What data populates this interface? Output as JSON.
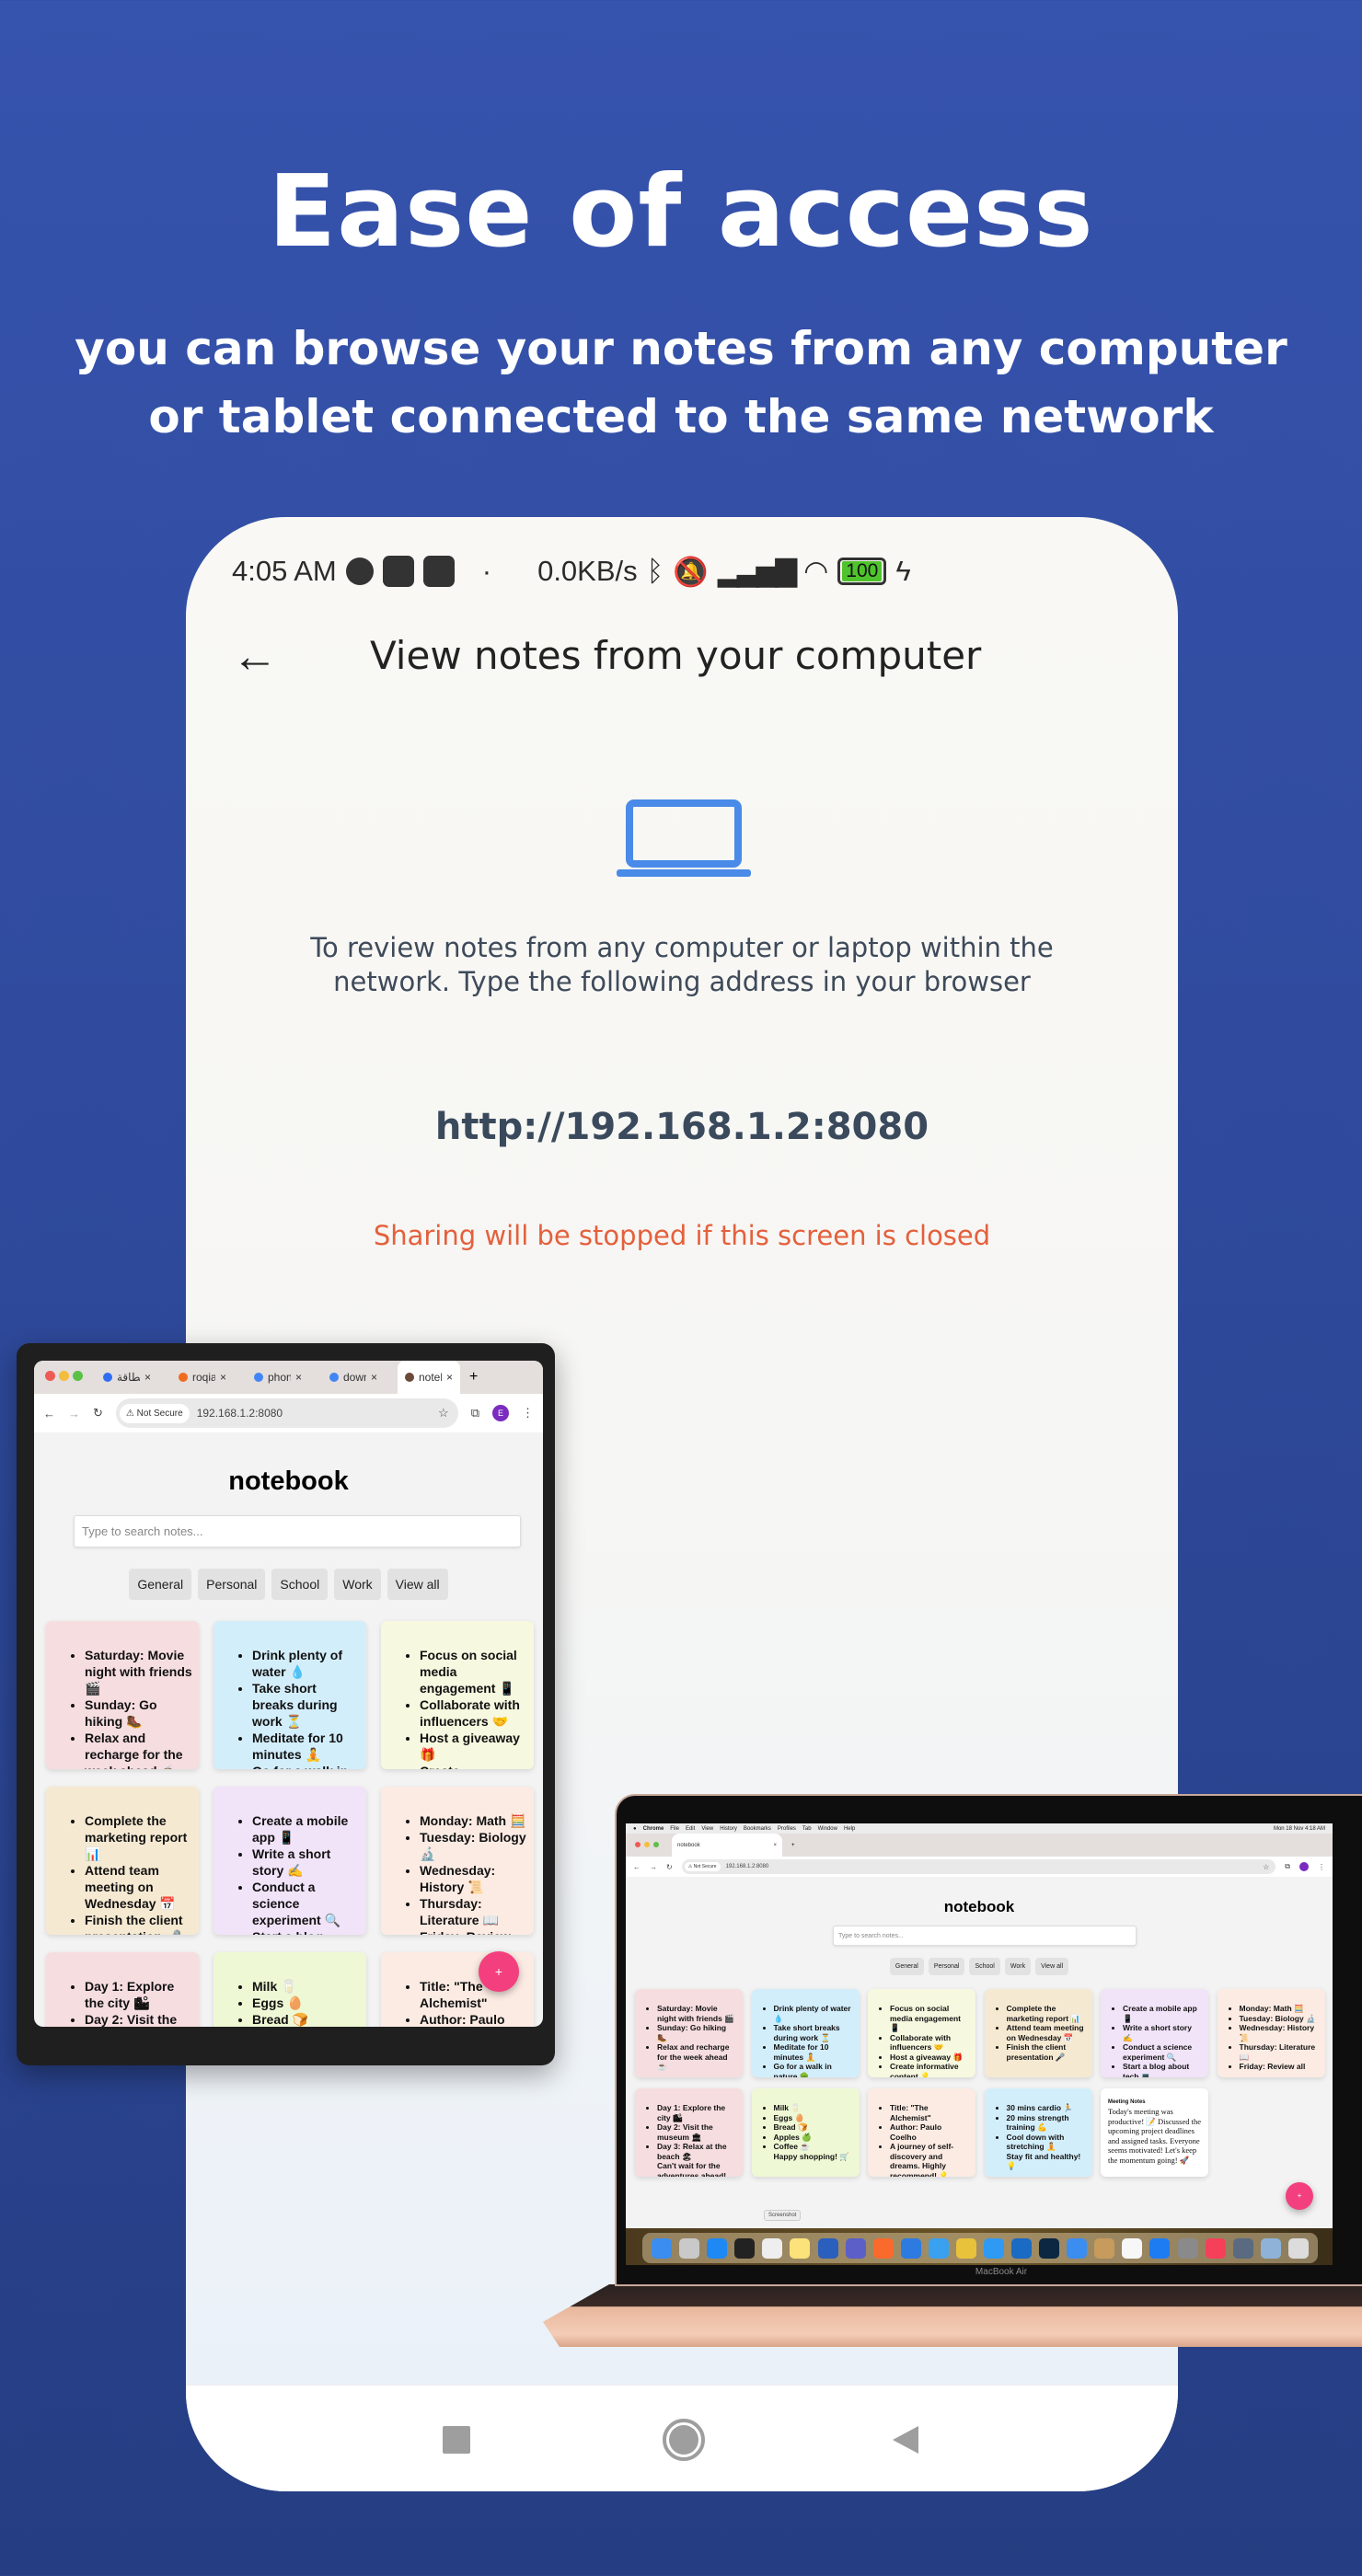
{
  "hero": {
    "title": "Ease of access",
    "subtitle_line1": "you can browse your notes from any computer",
    "subtitle_line2": "or tablet connected to the same network"
  },
  "phone": {
    "status": {
      "time": "4:05 AM",
      "speed": "0.0KB/s",
      "battery": "100"
    },
    "title": "View notes from your computer",
    "description": "To review notes from any computer or laptop within the network. Type the following address in your browser",
    "url": "http://192.168.1.2:8080",
    "warning": "Sharing will be stopped if this screen is closed",
    "colors": {
      "accent": "#4a8ae8",
      "warning": "#e4603c"
    }
  },
  "browser": {
    "not_secure": "Not Secure",
    "address": "192.168.1.2:8080",
    "tablet_tabs": [
      "بطاقة",
      "roqia",
      "phon",
      "down",
      "noteb"
    ],
    "laptop_tab": "notebook",
    "mac_menu": [
      "Chrome",
      "File",
      "Edit",
      "View",
      "History",
      "Bookmarks",
      "Profiles",
      "Tab",
      "Window",
      "Help"
    ],
    "mac_clock": "Mon 18 Nov 4:18 AM",
    "profile_initial": "E"
  },
  "notebook": {
    "title": "notebook",
    "search_placeholder": "Type to search notes...",
    "filters": [
      "General",
      "Personal",
      "School",
      "Work",
      "View all"
    ],
    "fab": "+",
    "notes": [
      {
        "color": "#f6dde0",
        "items": [
          "Saturday: Movie night with friends 🎬",
          "Sunday: Go hiking 🥾",
          "Relax and recharge for the week ahead ☕"
        ]
      },
      {
        "color": "#d3eefb",
        "items": [
          "Drink plenty of water 💧",
          "Take short breaks during work ⏳",
          "Meditate for 10 minutes 🧘",
          "Go for a walk in nature 🌳"
        ]
      },
      {
        "color": "#f6f8df",
        "items": [
          "Focus on social media engagement 📱",
          "Collaborate with influencers 🤝",
          "Host a giveaway 🎁",
          "Create informative content 💡"
        ]
      },
      {
        "color": "#f6e9d2",
        "items": [
          "Complete the marketing report 📊",
          "Attend team meeting on Wednesday 📅",
          "Finish the client presentation 🎤"
        ]
      },
      {
        "color": "#f1e3f8",
        "items": [
          "Create a mobile app 📱",
          "Write a short story ✍",
          "Conduct a science experiment 🔍",
          "Start a blog about tech 💻"
        ]
      },
      {
        "color": "#fbebe3",
        "items": [
          "Monday: Math 🧮",
          "Tuesday: Biology 🔬",
          "Wednesday: History 📜",
          "Thursday: Literature 📖",
          "Friday: Review all"
        ]
      },
      {
        "color": "#f6dde0",
        "items": [
          "Day 1: Explore the city 🏙",
          "Day 2: Visit the museum 🏛",
          "Day 3: Relax at the beach 🏖"
        ],
        "footer": "Can't wait for the adventures ahead!"
      },
      {
        "color": "#eef8d4",
        "items": [
          "Milk 🥛",
          "Eggs 🥚",
          "Bread 🍞",
          "Apples 🍏",
          "Coffee ☕"
        ],
        "footer": "Happy shopping! 🛒"
      },
      {
        "color": "#fbebe3",
        "items": [
          "Title: \"The Alchemist\"",
          "Author: Paulo Coelho",
          "A journey of self-discovery and dreams. Highly recommend! 💡"
        ]
      },
      {
        "color": "#d3eefb",
        "items": [
          "30 mins cardio 🏃",
          "20 mins strength training 💪",
          "Cool down with stretching 🧘"
        ],
        "footer": "Stay fit and healthy! 💡"
      },
      {
        "color": "#ffffff",
        "title": "Meeting Notes",
        "body": "Today's meeting was productive! 📝 Discussed the upcoming project deadlines and assigned tasks. Everyone seems motivated! Let's keep the momentum going! 🚀"
      }
    ]
  },
  "laptop": {
    "tooltip": "Screenshot",
    "model": "MacBook Air",
    "dock": [
      {
        "icon": "finder-icon",
        "color": "#3b8df0"
      },
      {
        "icon": "launchpad-icon",
        "color": "#c9c9c9"
      },
      {
        "icon": "app-store-icon",
        "color": "#1e88f5"
      },
      {
        "icon": "terminal-icon",
        "color": "#222"
      },
      {
        "icon": "screenshot-icon",
        "color": "#eee"
      },
      {
        "icon": "notes-icon",
        "color": "#fbe27a"
      },
      {
        "icon": "word-icon",
        "color": "#2b5fbd"
      },
      {
        "icon": "teams-icon",
        "color": "#5b5fc7"
      },
      {
        "icon": "pencil-app-icon",
        "color": "#fa6a2c"
      },
      {
        "icon": "xcode-instruments-icon",
        "color": "#2d7be0"
      },
      {
        "icon": "xcode-icon",
        "color": "#3aa0f0"
      },
      {
        "icon": "chrome-icon",
        "color": "#e9c23c"
      },
      {
        "icon": "safari-icon",
        "color": "#2e9af3"
      },
      {
        "icon": "outlook-icon",
        "color": "#1b6ac4"
      },
      {
        "icon": "photoshop-icon",
        "color": "#0b2741"
      },
      {
        "icon": "simulator-icon",
        "color": "#3b8df0"
      },
      {
        "icon": "contacts-icon",
        "color": "#c79a5e"
      },
      {
        "icon": "reminders-icon",
        "color": "#f7f7f7"
      },
      {
        "icon": "bluetooth-icon",
        "color": "#1e7cf2"
      },
      {
        "icon": "system-settings-icon",
        "color": "#8a8a8a"
      },
      {
        "icon": "music-icon",
        "color": "#f6405a"
      },
      {
        "icon": "quicktime-icon",
        "color": "#5a6a80"
      },
      {
        "icon": "preview-icon",
        "color": "#8fb3d8"
      },
      {
        "icon": "trash-icon",
        "color": "#dcdcdc"
      }
    ]
  }
}
